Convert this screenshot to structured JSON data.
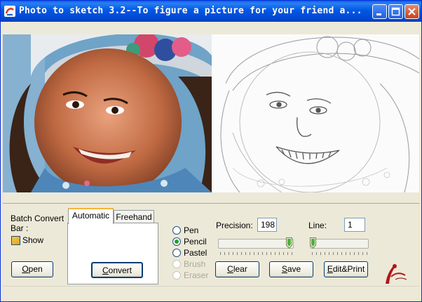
{
  "window": {
    "title": "Photo to sketch 3.2--To figure a picture for your friend a..."
  },
  "title_buttons": {
    "minimize": "minimize",
    "maximize": "maximize",
    "close": "close"
  },
  "left_panel": {
    "batch_label_1": "Batch Convert",
    "batch_label_2": "Bar :",
    "show_label": "Show",
    "open_button": "Open"
  },
  "tabs": {
    "automatic": "Automatic",
    "freehand": "Freehand",
    "convert_button": "Convert"
  },
  "tools": {
    "pen": "Pen",
    "pencil": "Pencil",
    "pastel": "Pastel",
    "brush": "Brush",
    "eraser": "Eraser",
    "selected": "Pencil"
  },
  "precision": {
    "label": "Precision:",
    "value": "198"
  },
  "line": {
    "label": "Line:",
    "value": "1"
  },
  "buttons": {
    "clear": "Clear",
    "save": "Save",
    "edit_print": "Edit&Print"
  },
  "colors": {
    "title_bar": "#0055e5",
    "window_bg": "#ece9d8",
    "radio_check": "#21a121"
  },
  "icons": {
    "app": "app-icon",
    "logo": "logo-icon"
  }
}
